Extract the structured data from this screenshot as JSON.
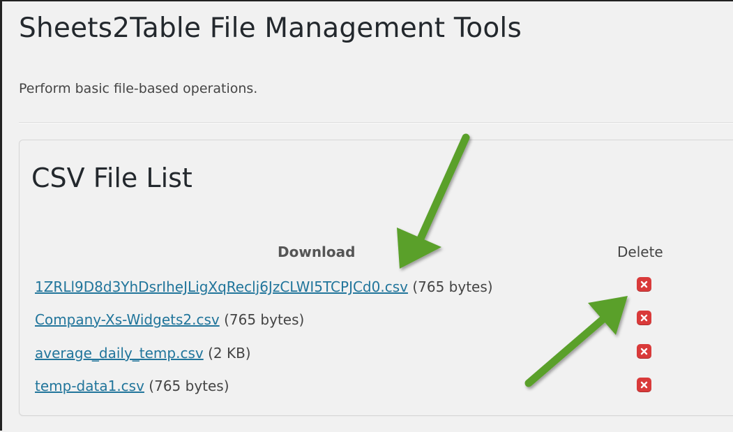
{
  "page": {
    "title": "Sheets2Table File Management Tools",
    "description": "Perform basic file-based operations."
  },
  "panel": {
    "title": "CSV File List",
    "download_header": "Download",
    "delete_header": "Delete"
  },
  "files": [
    {
      "name": "1ZRLl9D8d3YhDsrIheJLigXqReclj6JzCLWI5TCPJCd0.csv",
      "size": "(765 bytes)"
    },
    {
      "name": "Company-Xs-Widgets2.csv",
      "size": "(765 bytes)"
    },
    {
      "name": "average_daily_temp.csv",
      "size": "(2 KB)"
    },
    {
      "name": "temp-data1.csv",
      "size": "(765 bytes)"
    }
  ],
  "icons": {
    "delete": "close-x-icon",
    "annotation": "green-arrow"
  },
  "colors": {
    "link": "#21759b",
    "delete_button": "#d93a3a",
    "arrow": "#5aa02c",
    "background": "#f1f1f1"
  }
}
